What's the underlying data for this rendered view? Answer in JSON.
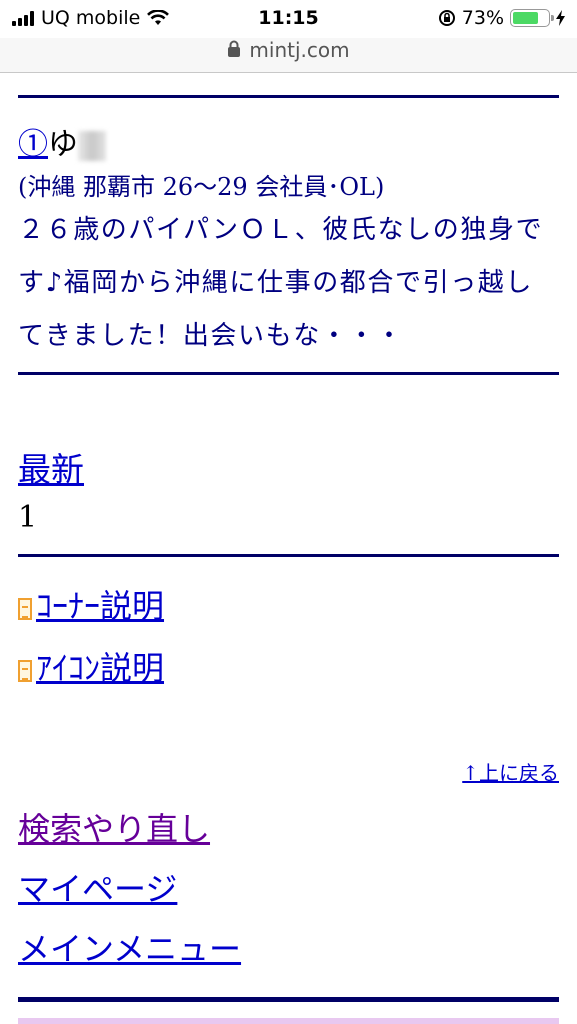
{
  "status_bar": {
    "carrier": "UQ mobile",
    "time": "11:15",
    "battery": "73%",
    "battery_level": 0.73
  },
  "browser": {
    "url": "mintj.com"
  },
  "profile": {
    "number": "①",
    "name_visible": "ゆ",
    "meta": "(沖縄 那覇市 26〜29 会社員･OL)",
    "message": "２６歳のパイパンＯＬ、彼氏なしの独身です♪福岡から沖縄に仕事の都合で引っ越してきました！出会いもな・・・"
  },
  "pagination": {
    "latest_label": "最新",
    "page": "1"
  },
  "help_links": {
    "corner": "ｺｰﾅｰ説明",
    "icon": "ｱｲｺﾝ説明"
  },
  "back_to_top": "↑上に戻る",
  "nav": {
    "search_again": "検索やり直し",
    "my_page": "マイページ",
    "main_menu": "メインメニュー"
  },
  "colors": {
    "divider": "#000066",
    "link": "#0000cc",
    "visited_link": "#660099",
    "message_text": "#000080"
  }
}
